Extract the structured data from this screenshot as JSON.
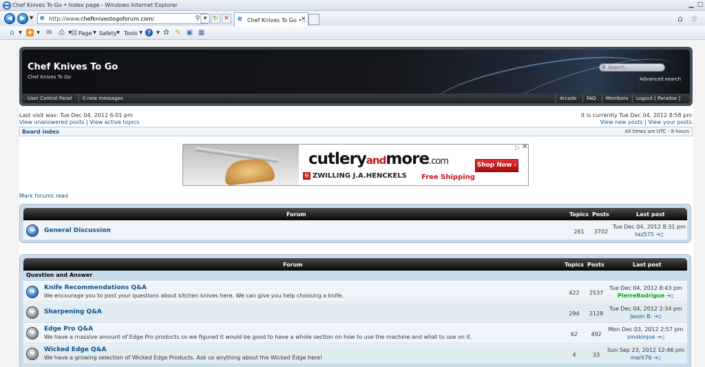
{
  "browser": {
    "title": "Chef Knives To Go • Index page - Windows Internet Explorer",
    "url_prefix": "http://www.",
    "url_domain": "chefknivestogoforum.com",
    "url_suffix": "/",
    "tab_label": "Chef Knives To Go •...",
    "menus": {
      "page": "Page",
      "safety": "Safety",
      "tools": "Tools"
    }
  },
  "header": {
    "site_name": "Chef Knives To Go",
    "site_desc": "Chef Knives To Go",
    "search_placeholder": "Search…",
    "advanced_search": "Advanced search",
    "user_control_panel": "User Control Panel",
    "new_messages": "0 new messages",
    "nav": {
      "arcade": "Arcade",
      "faq": "FAQ",
      "members": "Members",
      "logout": "Logout [ Paradox ]"
    }
  },
  "info": {
    "last_visit": "Last visit was: Tue Dec 04, 2012 6:01 pm",
    "unanswered": "View unanswered posts",
    "sep": "|",
    "active": "View active topics",
    "current_time": "It is currently Tue Dec 04, 2012 8:58 pm",
    "new_posts": "View new posts",
    "your_posts": "View your posts",
    "board_index": "Board index",
    "timezone": "All times are UTC - 8 hours",
    "mark_read": "Mark forums read"
  },
  "ad": {
    "brand_a": "cutlery",
    "brand_b": "and",
    "brand_c": "more",
    "brand_d": ".com",
    "maker": "ZWILLING J.A.HENCKELS",
    "shipping": "Free Shipping",
    "shop_now": "Shop Now ›"
  },
  "columns": {
    "forum": "Forum",
    "topics": "Topics",
    "posts": "Posts",
    "last_post": "Last post"
  },
  "panel1": {
    "forums": [
      {
        "title": "General Discussion",
        "topics": "261",
        "posts": "3702",
        "date": "Tue Dec 04, 2012 8:31 pm",
        "author": "taz575"
      }
    ]
  },
  "panel2": {
    "category": "Question and Answer",
    "forums": [
      {
        "title": "Knife Recommendations Q&A",
        "desc": "We encourage you to post your questions about kitchen knives here. We can give you help choosing a knife.",
        "topics": "422",
        "posts": "2537",
        "date": "Tue Dec 04, 2012 8:43 pm",
        "author": "PierreRodrigue"
      },
      {
        "title": "Sharpening Q&A",
        "desc": "",
        "topics": "294",
        "posts": "2128",
        "date": "Tue Dec 04, 2012 2:34 pm",
        "author": "Jason B."
      },
      {
        "title": "Edge Pro Q&A",
        "desc": "We have a massive amount of Edge Pro products so we figured it would be good to have a whole section on how to use the machine and what to use on it.",
        "topics": "62",
        "posts": "492",
        "date": "Mon Dec 03, 2012 2:57 pm",
        "author": "smokinjoe"
      },
      {
        "title": "Wicked Edge Q&A",
        "desc": "We have a growing selection of Wicked Edge Products. Ask us anything about the Wicked Edge here!",
        "topics": "4",
        "posts": "33",
        "date": "Sun Sep 23, 2012 12:46 pm",
        "author": "mark76"
      }
    ]
  }
}
